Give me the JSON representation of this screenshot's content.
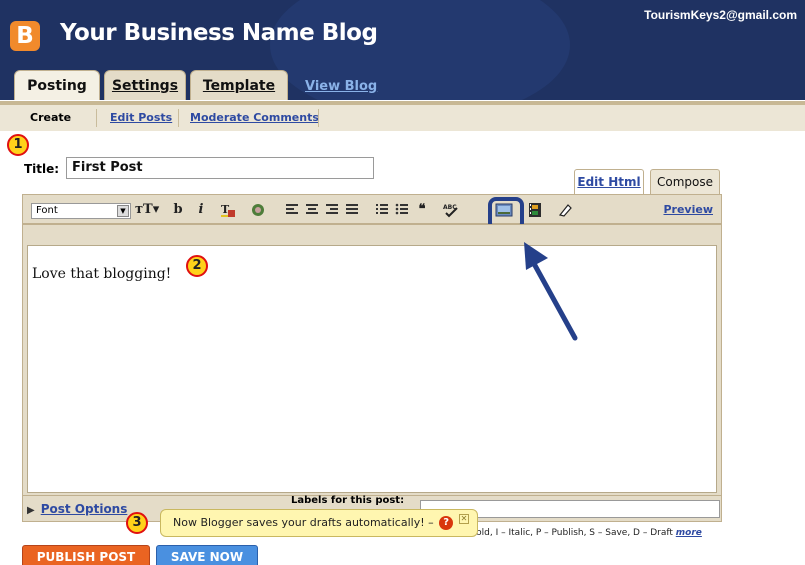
{
  "header": {
    "logo": "B",
    "blog_title": "Your Business Name Blog",
    "user_email": "TourismKeys2@gmail.com",
    "tabs": [
      {
        "label": "Posting"
      },
      {
        "label": "Settings"
      },
      {
        "label": "Template"
      }
    ],
    "view_blog": "View Blog"
  },
  "subnav": {
    "items": [
      {
        "label": "Create"
      },
      {
        "label": "Edit Posts"
      },
      {
        "label": "Moderate Comments"
      }
    ]
  },
  "post": {
    "title_label": "Title:",
    "title_value": "First Post",
    "body": "Love that blogging!"
  },
  "editor_modes": {
    "edit_html": "Edit Html",
    "compose": "Compose"
  },
  "toolbar": {
    "font": "Font",
    "preview": "Preview",
    "icons": [
      "text-size-icon",
      "bold-icon",
      "italic-icon",
      "text-color-icon",
      "link-icon",
      "align-left-icon",
      "align-center-icon",
      "align-right-icon",
      "justify-icon",
      "numbered-list-icon",
      "bulleted-list-icon",
      "blockquote-icon",
      "spellcheck-icon",
      "add-image-icon",
      "add-video-icon",
      "remove-formatting-icon"
    ]
  },
  "bottom": {
    "post_options": "Post Options",
    "labels_label": "Labels for this post:",
    "shortcuts": "Bold, I – Italic, P – Publish, S – Save, D – Draft",
    "shortcuts_more": "more"
  },
  "tooltip": {
    "text": "Now Blogger saves your drafts automatically! –",
    "help": "?"
  },
  "buttons": {
    "publish": "PUBLISH POST",
    "save": "SAVE NOW"
  },
  "markers": {
    "m1": "1",
    "m2": "2",
    "m3": "3"
  },
  "colors": {
    "header_bg": "#1f3262",
    "logo_orange": "#f18a2c",
    "publish_orange": "#ea6422",
    "save_blue": "#4a90e0",
    "link_blue": "#2e4aa2",
    "annotation_arrow": "#25408a",
    "marker_fill": "#ffd21a",
    "marker_border": "#e01010"
  }
}
